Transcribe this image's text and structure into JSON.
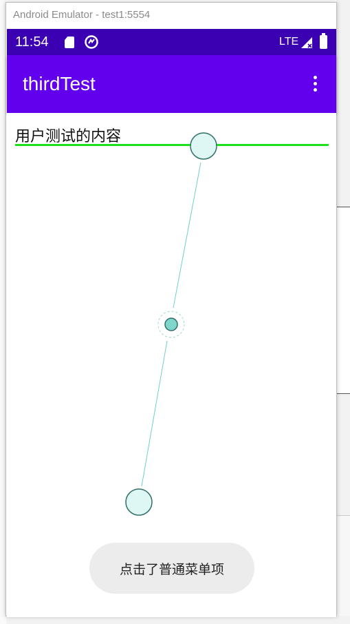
{
  "window": {
    "title": "Android Emulator - test1:5554"
  },
  "status_bar": {
    "time": "11:54",
    "network": "LTE",
    "icons": [
      "sd-card-icon",
      "sync-icon",
      "signal-icon",
      "battery-icon"
    ]
  },
  "app_bar": {
    "title": "thirdTest",
    "menu_icon": "overflow-menu-icon"
  },
  "content": {
    "label": "用户测试的内容",
    "underline_color": "#1de01d"
  },
  "toast": {
    "message": "点击了普通菜单项"
  },
  "colors": {
    "status_bar": "#3a00b2",
    "app_bar": "#6200ee",
    "handle_fill": "#dff7f4",
    "handle_stroke": "#2f6e66",
    "center_fill": "#7fd6cb"
  }
}
